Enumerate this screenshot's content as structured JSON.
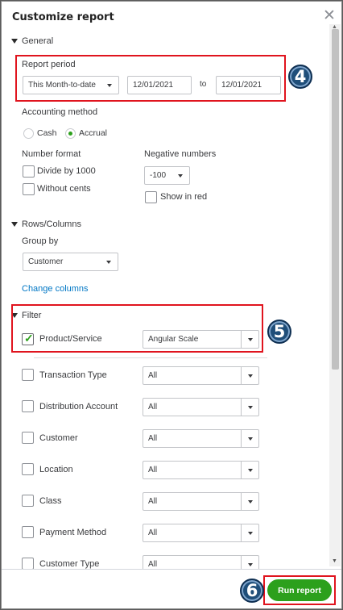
{
  "dialog": {
    "title": "Customize report",
    "close_glyph": "✕"
  },
  "general": {
    "section_label": "General",
    "report_period": {
      "label": "Report period",
      "preset": "This Month-to-date",
      "from": "12/01/2021",
      "to_label": "to",
      "to": "12/01/2021"
    },
    "accounting_method": {
      "label": "Accounting method",
      "options": [
        "Cash",
        "Accrual"
      ],
      "selected": "Accrual"
    },
    "number_format": {
      "label": "Number format",
      "divide_by_1000": "Divide by 1000",
      "without_cents": "Without cents"
    },
    "negative_numbers": {
      "label": "Negative numbers",
      "value": "-100",
      "show_in_red": "Show in red"
    }
  },
  "rows_columns": {
    "section_label": "Rows/Columns",
    "group_by_label": "Group by",
    "group_by_value": "Customer",
    "change_columns": "Change columns"
  },
  "filter": {
    "section_label": "Filter",
    "items": [
      {
        "label": "Product/Service",
        "value": "Angular Scale",
        "checked": true
      },
      {
        "label": "Transaction Type",
        "value": "All",
        "checked": false
      },
      {
        "label": "Distribution Account",
        "value": "All",
        "checked": false
      },
      {
        "label": "Customer",
        "value": "All",
        "checked": false
      },
      {
        "label": "Location",
        "value": "All",
        "checked": false
      },
      {
        "label": "Class",
        "value": "All",
        "checked": false
      },
      {
        "label": "Payment Method",
        "value": "All",
        "checked": false
      },
      {
        "label": "Customer Type",
        "value": "All",
        "checked": false
      }
    ]
  },
  "footer": {
    "run_report": "Run report"
  },
  "callouts": {
    "step4": "4",
    "step5": "5",
    "step6": "6"
  },
  "colors": {
    "accent_green": "#2ca01c",
    "link_blue": "#0077c5",
    "highlight_red": "#e0141e",
    "badge_blue": "#1f4e79"
  }
}
